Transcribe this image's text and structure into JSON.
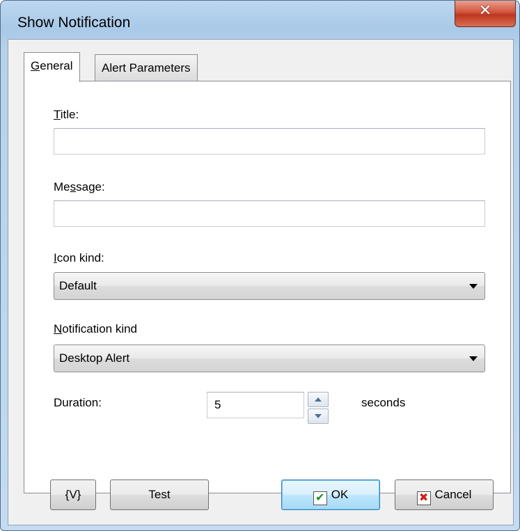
{
  "window": {
    "title": "Show Notification",
    "close_glyph": "✕"
  },
  "tabs": [
    {
      "label": "General",
      "mnemonic": "G",
      "rest": "eneral",
      "active": true
    },
    {
      "label": "Alert Parameters",
      "active": false
    }
  ],
  "form": {
    "title_label_m": "T",
    "title_label_rest": "itle:",
    "title_value": "",
    "message_label_pre": "Me",
    "message_label_m": "s",
    "message_label_rest": "sage:",
    "message_value": "",
    "icon_kind_label_m": "I",
    "icon_kind_label_rest": "con kind:",
    "icon_kind_value": "Default",
    "notification_kind_label_m": "N",
    "notification_kind_label_rest": "otification kind",
    "notification_kind_value": "Desktop Alert",
    "duration_label": "Duration:",
    "duration_value": "5",
    "duration_unit": "seconds"
  },
  "buttons": {
    "variables": "{V}",
    "test": "Test",
    "ok": "OK",
    "ok_icon": "✔",
    "cancel": "Cancel",
    "cancel_icon": "✖"
  }
}
